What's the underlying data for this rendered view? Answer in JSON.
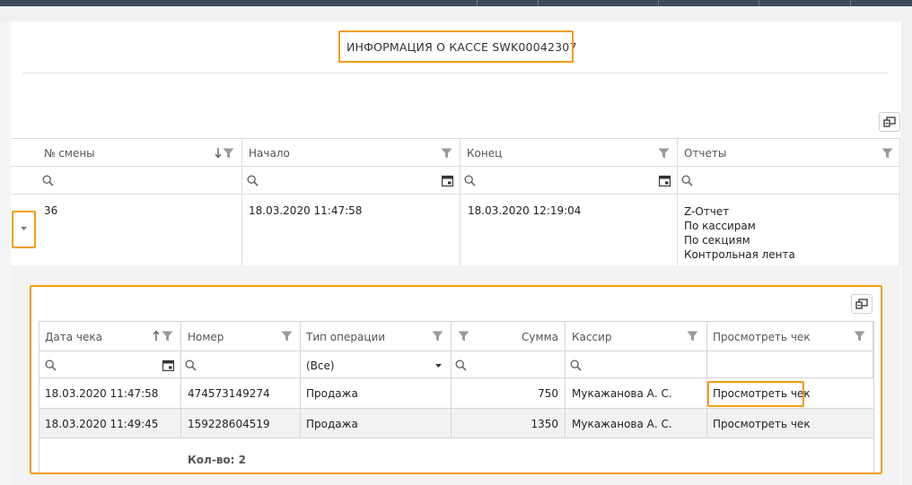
{
  "title": "ИНФОРМАЦИЯ О КАССЕ SWK00042307",
  "shifts_table": {
    "columns": [
      "№ смены",
      "Начало",
      "Конец",
      "Отчеты"
    ],
    "row": {
      "shift": "36",
      "start": "18.03.2020 11:47:58",
      "end": "18.03.2020 12:19:04",
      "reports": [
        "Z-Отчет",
        "По кассирам",
        "По секциям",
        "Контрольная лента"
      ]
    }
  },
  "receipts_table": {
    "columns": [
      "Дата чека",
      "Номер",
      "Тип операции",
      "Сумма",
      "Кассир",
      "Просмотреть чек"
    ],
    "operation_filter": "(Все)",
    "rows": [
      {
        "date": "18.03.2020 11:47:58",
        "number": "474573149274",
        "type": "Продажа",
        "sum": "750",
        "cashier": "Мукажанова А. С.",
        "view": "Просмотреть чек"
      },
      {
        "date": "18.03.2020 11:49:45",
        "number": "159228604519",
        "type": "Продажа",
        "sum": "1350",
        "cashier": "Мукажанова А. С.",
        "view": "Просмотреть чек"
      }
    ],
    "total": "Кол-во: 2"
  },
  "colors": {
    "highlight": "#f29d12",
    "topbar": "#3d4a5a"
  },
  "icons": [
    "filter-icon",
    "sort-down-icon",
    "sort-up-icon",
    "search-icon",
    "calendar-icon",
    "expand-arrow-icon",
    "column-chooser-icon",
    "dropdown-arrow-icon"
  ]
}
